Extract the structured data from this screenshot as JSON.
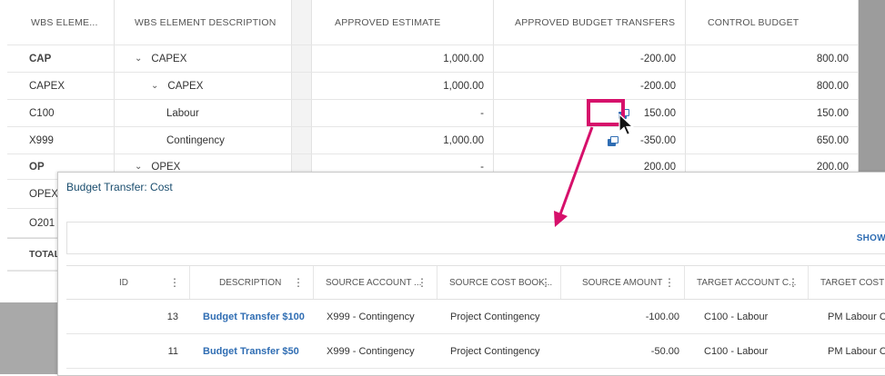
{
  "main_grid": {
    "headers": {
      "wbs_element": "WBS ELEME...",
      "wbs_description": "WBS ELEMENT DESCRIPTION",
      "approved_estimate": "APPROVED ESTIMATE",
      "approved_budget_transfers": "APPROVED BUDGET TRANSFERS",
      "control_budget": "CONTROL BUDGET"
    },
    "rows": [
      {
        "wbs": "CAP",
        "desc": "CAPEX",
        "estimate": "1,000.00",
        "transfers": "-200.00",
        "control": "800.00"
      },
      {
        "wbs": "CAPEX",
        "desc": "CAPEX",
        "estimate": "1,000.00",
        "transfers": "-200.00",
        "control": "800.00"
      },
      {
        "wbs": "C100",
        "desc": "Labour",
        "estimate": "-",
        "transfers": "150.00",
        "control": "150.00"
      },
      {
        "wbs": "X999",
        "desc": "Contingency",
        "estimate": "1,000.00",
        "transfers": "-350.00",
        "control": "650.00"
      },
      {
        "wbs": "OP",
        "desc": "OPEX",
        "estimate": "-",
        "transfers": "200.00",
        "control": "200.00"
      },
      {
        "wbs": "OPEX",
        "desc": "",
        "estimate": "",
        "transfers": "",
        "control": ""
      },
      {
        "wbs": "O201",
        "desc": "",
        "estimate": "",
        "transfers": "",
        "control": ""
      },
      {
        "wbs": "TOTAL",
        "desc": "",
        "estimate": "",
        "transfers": "",
        "control": ""
      }
    ]
  },
  "dialog": {
    "title": "Budget Transfer: Cost",
    "show_button": "SHOW",
    "headers": {
      "id": "ID",
      "description": "DESCRIPTION",
      "source_account": "SOURCE ACCOUNT ...",
      "source_cost_book": "SOURCE COST BOOK...",
      "source_amount": "SOURCE AMOUNT",
      "target_account": "TARGET ACCOUNT C...",
      "target_cost_book": "TARGET COST BO"
    },
    "rows": [
      {
        "id": "13",
        "description": "Budget Transfer $100",
        "source_account": "X999 - Contingency",
        "source_cost_book": "Project Contingency",
        "source_amount": "-100.00",
        "target_account": "C100 - Labour",
        "target_cost_book": "PM Labour Co"
      },
      {
        "id": "11",
        "description": "Budget Transfer $50",
        "source_account": "X999 - Contingency",
        "source_cost_book": "Project Contingency",
        "source_amount": "-50.00",
        "target_account": "C100 - Labour",
        "target_cost_book": "PM Labour Co"
      }
    ]
  },
  "icons": {
    "transfer": "budget-transfer-icon",
    "chevron": "chevron-down-icon",
    "kebab": "column-menu-icon",
    "cursor": "mouse-pointer-icon"
  },
  "colors": {
    "highlight": "#d6106b",
    "link": "#2f6db3",
    "dialog_title": "#1a4d6e"
  }
}
